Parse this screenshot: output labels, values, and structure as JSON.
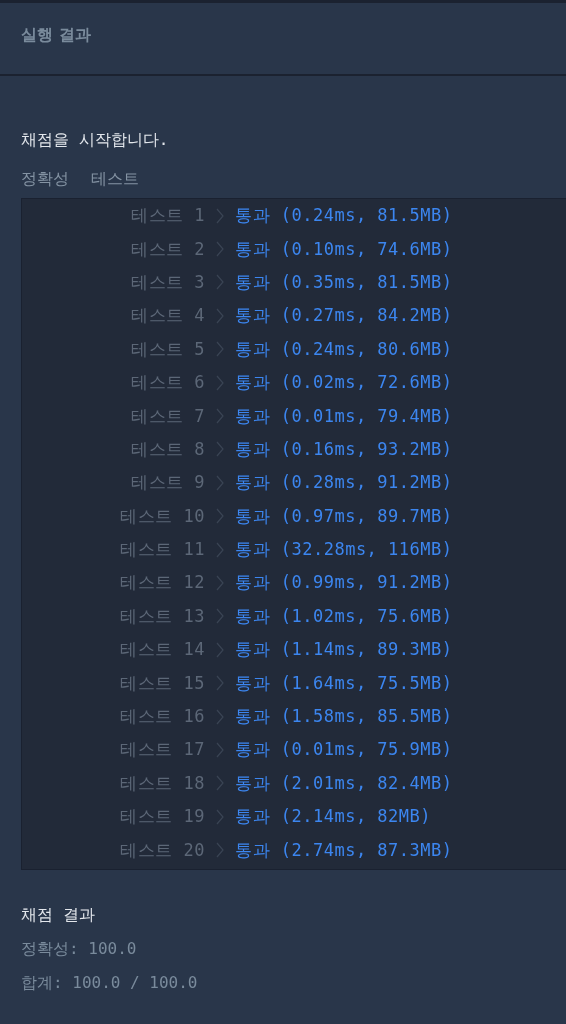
{
  "panel": {
    "title": "실행 결과"
  },
  "intro": "채점을 시작합니다.",
  "section": {
    "category": "정확성",
    "label": "테스트"
  },
  "tests": [
    {
      "label": "테스트 1",
      "result": "통과 (0.24ms, 81.5MB)",
      "kind": "pass"
    },
    {
      "label": "테스트 2",
      "result": "통과 (0.10ms, 74.6MB)",
      "kind": "pass"
    },
    {
      "label": "테스트 3",
      "result": "통과 (0.35ms, 81.5MB)",
      "kind": "pass"
    },
    {
      "label": "테스트 4",
      "result": "통과 (0.27ms, 84.2MB)",
      "kind": "pass"
    },
    {
      "label": "테스트 5",
      "result": "통과 (0.24ms, 80.6MB)",
      "kind": "pass"
    },
    {
      "label": "테스트 6",
      "result": "통과 (0.02ms, 72.6MB)",
      "kind": "pass"
    },
    {
      "label": "테스트 7",
      "result": "통과 (0.01ms, 79.4MB)",
      "kind": "pass"
    },
    {
      "label": "테스트 8",
      "result": "통과 (0.16ms, 93.2MB)",
      "kind": "pass"
    },
    {
      "label": "테스트 9",
      "result": "통과 (0.28ms, 91.2MB)",
      "kind": "pass"
    },
    {
      "label": "테스트 10",
      "result": "통과 (0.97ms, 89.7MB)",
      "kind": "pass"
    },
    {
      "label": "테스트 11",
      "result": "통과 (32.28ms, 116MB)",
      "kind": "pass"
    },
    {
      "label": "테스트 12",
      "result": "통과 (0.99ms, 91.2MB)",
      "kind": "pass"
    },
    {
      "label": "테스트 13",
      "result": "통과 (1.02ms, 75.6MB)",
      "kind": "pass"
    },
    {
      "label": "테스트 14",
      "result": "통과 (1.14ms, 89.3MB)",
      "kind": "pass"
    },
    {
      "label": "테스트 15",
      "result": "통과 (1.64ms, 75.5MB)",
      "kind": "pass"
    },
    {
      "label": "테스트 16",
      "result": "통과 (1.58ms, 85.5MB)",
      "kind": "pass"
    },
    {
      "label": "테스트 17",
      "result": "통과 (0.01ms, 75.9MB)",
      "kind": "pass"
    },
    {
      "label": "테스트 18",
      "result": "통과 (2.01ms, 82.4MB)",
      "kind": "pass"
    },
    {
      "label": "테스트 19",
      "result": "통과 (2.14ms, 82MB)",
      "kind": "pass"
    },
    {
      "label": "테스트 20",
      "result": "통과 (2.74ms, 87.3MB)",
      "kind": "pass"
    }
  ],
  "summary": {
    "title": "채점 결과",
    "lines": [
      "정확성: 100.0",
      "합계: 100.0 / 100.0"
    ]
  }
}
